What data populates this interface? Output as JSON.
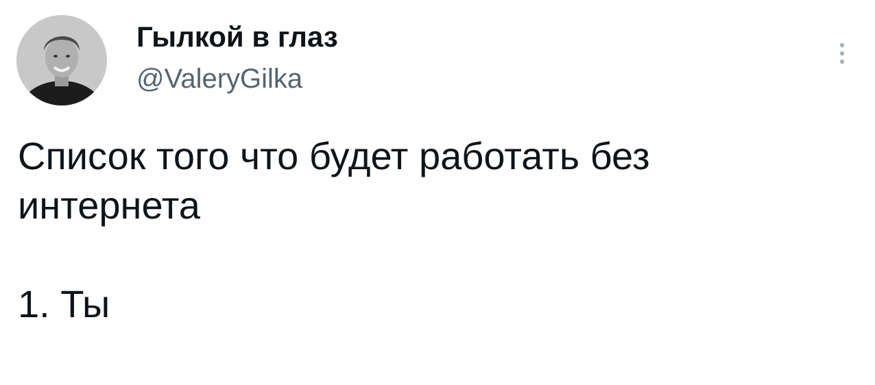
{
  "author": {
    "display_name": "Гылкой в глаз",
    "handle": "@ValeryGilka",
    "avatar_icon": "user-avatar-photo"
  },
  "more_icon": "more-vertical-icon",
  "tweet": {
    "line_1": "Список того что будет работать без",
    "line_2": "интернета",
    "line_3": "1. Ты"
  },
  "colors": {
    "text_primary": "#0f1419",
    "text_secondary": "#536471",
    "background": "#ffffff"
  }
}
